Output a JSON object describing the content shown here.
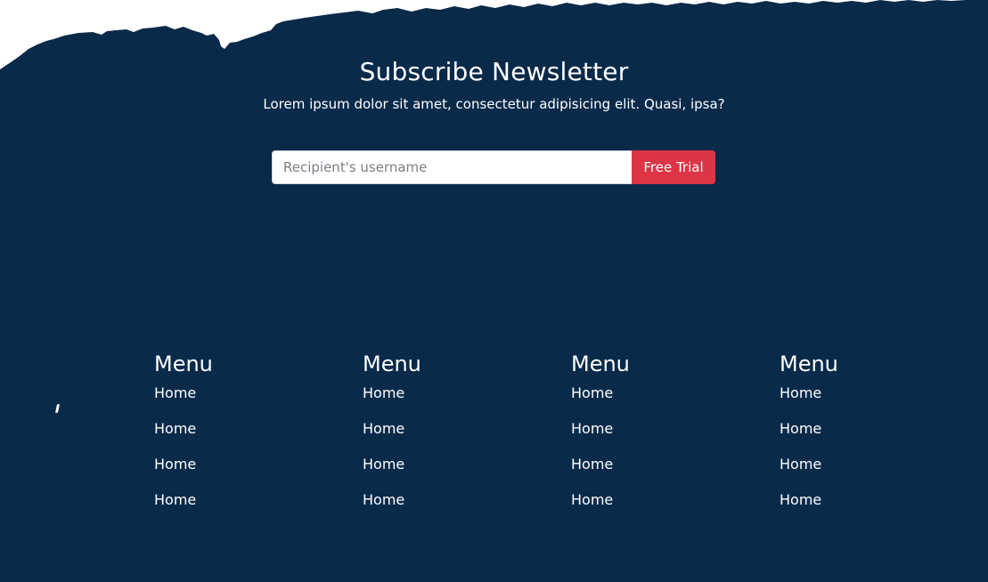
{
  "theme": {
    "background": "#0a2a4a",
    "accent": "#dc3545",
    "text": "#ffffff"
  },
  "newsletter": {
    "title": "Subscribe Newsletter",
    "description": "Lorem ipsum dolor sit amet, consectetur adipisicing elit. Quasi, ipsa?",
    "input_value": "",
    "input_placeholder": "Recipient's username",
    "button_label": "Free Trial"
  },
  "menus": [
    {
      "title": "Menu",
      "items": [
        "Home",
        "Home",
        "Home",
        "Home"
      ]
    },
    {
      "title": "Menu",
      "items": [
        "Home",
        "Home",
        "Home",
        "Home"
      ]
    },
    {
      "title": "Menu",
      "items": [
        "Home",
        "Home",
        "Home",
        "Home"
      ]
    },
    {
      "title": "Menu",
      "items": [
        "Home",
        "Home",
        "Home",
        "Home"
      ]
    }
  ]
}
